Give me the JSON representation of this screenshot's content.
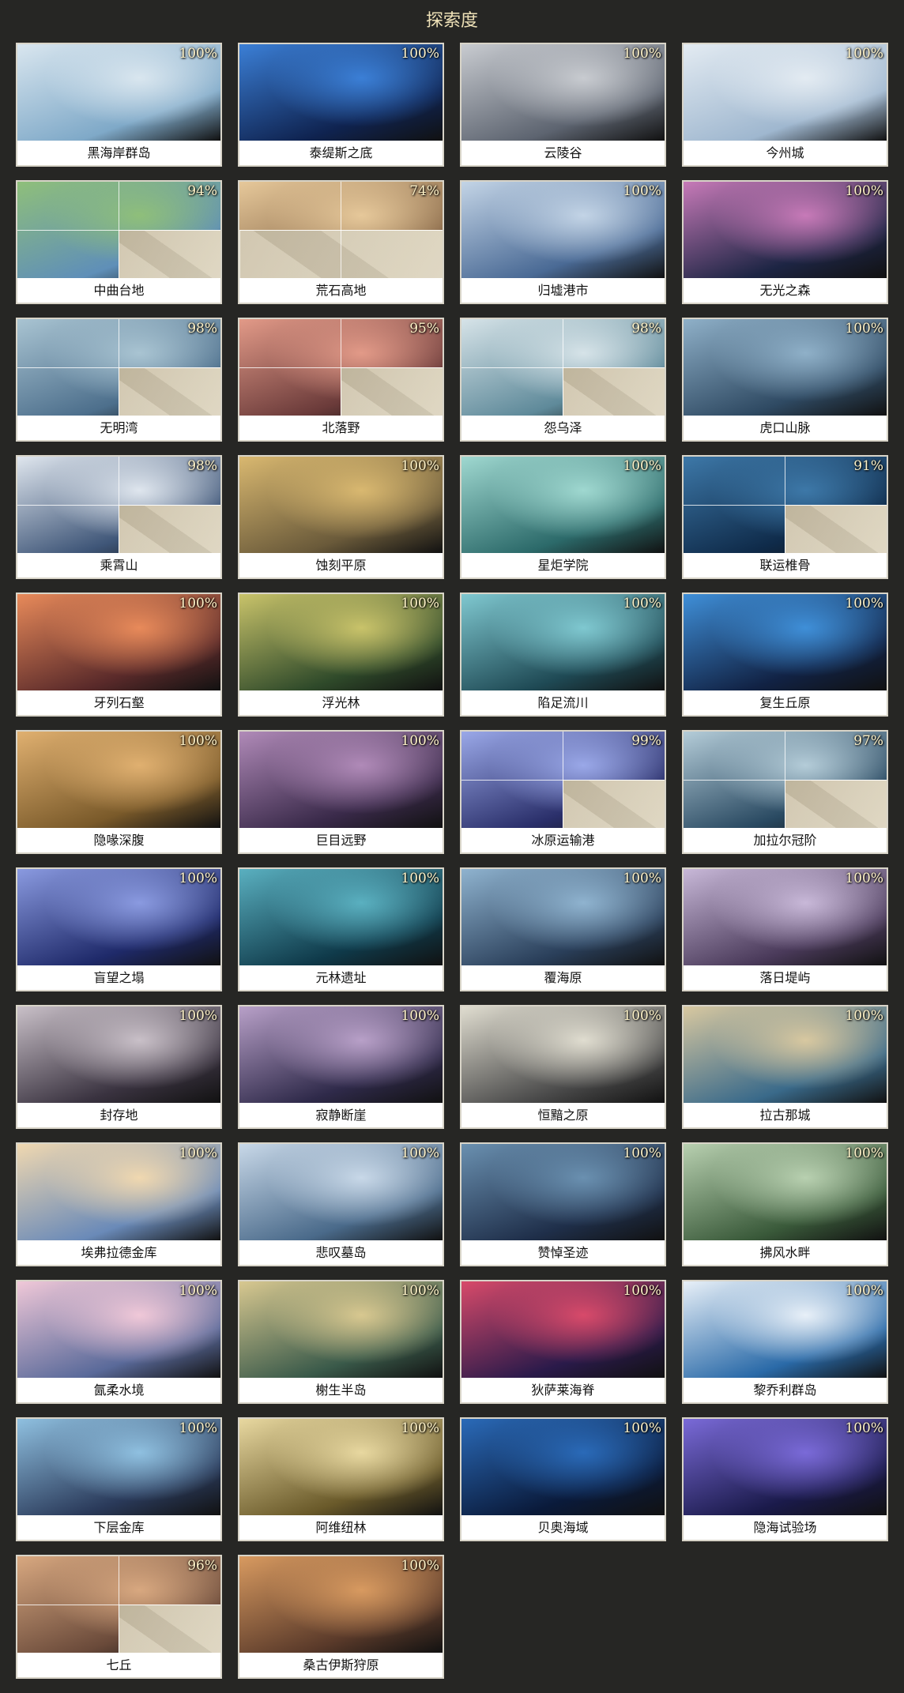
{
  "header": {
    "title": "探索度"
  },
  "regions": [
    {
      "name": "黑海岸群岛",
      "pct": "100%",
      "c1": "#7fa9c8",
      "c2": "#d9e6ef",
      "split": "none"
    },
    {
      "name": "泰缇斯之底",
      "pct": "100%",
      "c1": "#0f2350",
      "c2": "#3b7fd6",
      "split": "none"
    },
    {
      "name": "云陵谷",
      "pct": "100%",
      "c1": "#5d6470",
      "c2": "#c8cbd0",
      "split": "none"
    },
    {
      "name": "今州城",
      "pct": "100%",
      "c1": "#9fb7cf",
      "c2": "#e3ebf2",
      "split": "none"
    },
    {
      "name": "中曲台地",
      "pct": "94%",
      "c1": "#5f8fb8",
      "c2": "#8fbf7a",
      "split": "quad"
    },
    {
      "name": "荒石高地",
      "pct": "74%",
      "c1": "#8a6a4a",
      "c2": "#e6c89a",
      "split": "half"
    },
    {
      "name": "归墟港市",
      "pct": "100%",
      "c1": "#4a6a95",
      "c2": "#c3d4e6",
      "split": "none"
    },
    {
      "name": "无光之森",
      "pct": "100%",
      "c1": "#1d2544",
      "c2": "#c77ab8",
      "split": "none"
    },
    {
      "name": "无明湾",
      "pct": "98%",
      "c1": "#4d6f8c",
      "c2": "#a9c4d2",
      "split": "quad"
    },
    {
      "name": "北落野",
      "pct": "95%",
      "c1": "#6b3b3a",
      "c2": "#e29a88",
      "split": "quad"
    },
    {
      "name": "怨乌泽",
      "pct": "98%",
      "c1": "#5f8a9a",
      "c2": "#d6e3e8",
      "split": "quad"
    },
    {
      "name": "虎口山脉",
      "pct": "100%",
      "c1": "#2f4a63",
      "c2": "#8fb0c8",
      "split": "none"
    },
    {
      "name": "乘霄山",
      "pct": "98%",
      "c1": "#3f5678",
      "c2": "#dfe6ee",
      "split": "quad"
    },
    {
      "name": "蚀刻平原",
      "pct": "100%",
      "c1": "#6a5a3a",
      "c2": "#d9b870",
      "split": "none"
    },
    {
      "name": "星炬学院",
      "pct": "100%",
      "c1": "#2c6a6a",
      "c2": "#9fd8d0",
      "split": "none"
    },
    {
      "name": "联运椎骨",
      "pct": "91%",
      "c1": "#0f2b4a",
      "c2": "#3d78a8",
      "split": "quad"
    },
    {
      "name": "牙列石壑",
      "pct": "100%",
      "c1": "#5a2a2a",
      "c2": "#e88a5a",
      "split": "none"
    },
    {
      "name": "浮光林",
      "pct": "100%",
      "c1": "#2f4a2a",
      "c2": "#c9c36a",
      "split": "none"
    },
    {
      "name": "陷足流川",
      "pct": "100%",
      "c1": "#1f4a55",
      "c2": "#7fc8d0",
      "split": "none"
    },
    {
      "name": "复生丘原",
      "pct": "100%",
      "c1": "#112244",
      "c2": "#3f8fd8",
      "split": "none"
    },
    {
      "name": "隐喙深腹",
      "pct": "100%",
      "c1": "#7a5a2a",
      "c2": "#e0b070",
      "split": "none"
    },
    {
      "name": "巨目远野",
      "pct": "100%",
      "c1": "#3a2a4a",
      "c2": "#b08ab8",
      "split": "none"
    },
    {
      "name": "冰原运输港",
      "pct": "99%",
      "c1": "#2a2f6a",
      "c2": "#9aa8e8",
      "split": "quad"
    },
    {
      "name": "加拉尔冠阶",
      "pct": "97%",
      "c1": "#2a4a62",
      "c2": "#b4ccd8",
      "split": "quad"
    },
    {
      "name": "盲望之塌",
      "pct": "100%",
      "c1": "#1f2a6a",
      "c2": "#8a9ae0",
      "split": "none"
    },
    {
      "name": "元林遗址",
      "pct": "100%",
      "c1": "#0f3a4a",
      "c2": "#5ab0c0",
      "split": "none"
    },
    {
      "name": "覆海原",
      "pct": "100%",
      "c1": "#2a3f5a",
      "c2": "#8fb3cf",
      "split": "none"
    },
    {
      "name": "落日堤屿",
      "pct": "100%",
      "c1": "#4a3a5a",
      "c2": "#c8b8d8",
      "split": "none"
    },
    {
      "name": "封存地",
      "pct": "100%",
      "c1": "#3a3340",
      "c2": "#c9c0c8",
      "split": "none"
    },
    {
      "name": "寂静断崖",
      "pct": "100%",
      "c1": "#2f2a4a",
      "c2": "#b8a0c8",
      "split": "none"
    },
    {
      "name": "恒黯之原",
      "pct": "100%",
      "c1": "#4a4a4a",
      "c2": "#e0ddd0",
      "split": "none"
    },
    {
      "name": "拉古那城",
      "pct": "100%",
      "c1": "#3a6a8a",
      "c2": "#d8c8a0",
      "split": "none"
    },
    {
      "name": "埃弗拉德金库",
      "pct": "100%",
      "c1": "#6a8ab8",
      "c2": "#f0d8b0",
      "split": "none"
    },
    {
      "name": "悲叹墓岛",
      "pct": "100%",
      "c1": "#4a6a8a",
      "c2": "#c8d8e8",
      "split": "none"
    },
    {
      "name": "赞悼圣迹",
      "pct": "100%",
      "c1": "#1f2f4a",
      "c2": "#6a90b0",
      "split": "none"
    },
    {
      "name": "拂风水畔",
      "pct": "100%",
      "c1": "#3a5a3a",
      "c2": "#b8d0b0",
      "split": "none"
    },
    {
      "name": "氤柔水境",
      "pct": "100%",
      "c1": "#5a6a9a",
      "c2": "#f0c8d8",
      "split": "none"
    },
    {
      "name": "榭生半岛",
      "pct": "100%",
      "c1": "#3a5a4a",
      "c2": "#d8c890",
      "split": "none"
    },
    {
      "name": "狄萨莱海脊",
      "pct": "100%",
      "c1": "#2a1a4a",
      "c2": "#d84a6a",
      "split": "none"
    },
    {
      "name": "黎乔利群岛",
      "pct": "100%",
      "c1": "#2a6aa8",
      "c2": "#e8f0f8",
      "split": "none"
    },
    {
      "name": "下层金库",
      "pct": "100%",
      "c1": "#2a3a5a",
      "c2": "#8fc0e0",
      "split": "none"
    },
    {
      "name": "阿维纽林",
      "pct": "100%",
      "c1": "#6a5a2a",
      "c2": "#e8d8a0",
      "split": "none"
    },
    {
      "name": "贝奥海域",
      "pct": "100%",
      "c1": "#0a1a3a",
      "c2": "#2a6ab8",
      "split": "none"
    },
    {
      "name": "隐海试验场",
      "pct": "100%",
      "c1": "#1a1a4a",
      "c2": "#7a6ad8",
      "split": "none"
    },
    {
      "name": "七丘",
      "pct": "96%",
      "c1": "#6a4a3a",
      "c2": "#d8a880",
      "split": "quad"
    },
    {
      "name": "桑古伊斯狩原",
      "pct": "100%",
      "c1": "#5a3a2a",
      "c2": "#d89a60",
      "split": "none"
    }
  ]
}
